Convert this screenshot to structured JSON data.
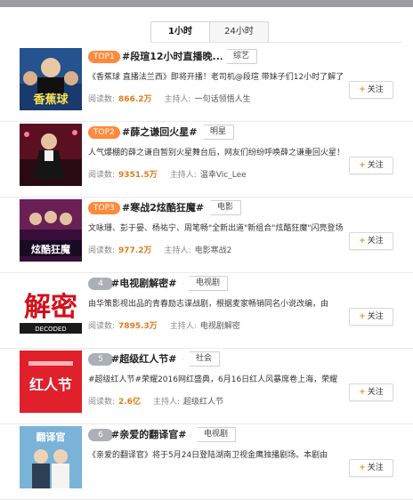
{
  "tabs": [
    {
      "label": "1小时",
      "active": true
    },
    {
      "label": "24小时",
      "active": false
    }
  ],
  "items": [
    {
      "rank": "TOP1",
      "title": "#段瑄12小时直播晚...",
      "category": "综艺",
      "description": "《香蕉球 直播法兰西》即将开播！老司机@段瑄 带妹子们12小时了解了",
      "read_label": "阅读数:",
      "read_count": "866.2万",
      "host_label": "主持人:",
      "host": "一句话领悟人生",
      "follow": "关注",
      "thumb_text": "香蕉球",
      "thumb_color": "#1a3a6e"
    },
    {
      "rank": "TOP2",
      "title": "#薛之谦回火星#",
      "category": "明星",
      "description": "人气爆棚的薛之谦自暂别火星舞台后，网友们纷纷呼唤薛之谦重回火星！",
      "read_label": "阅读数:",
      "read_count": "9351.5万",
      "host_label": "主持人:",
      "host": "温幸Vic_Lee",
      "follow": "关注",
      "thumb_text": "",
      "thumb_color": "#5a1020"
    },
    {
      "rank": "TOP3",
      "title": "#寒战2炫酷狂魔#",
      "category": "电影",
      "description": "文咏珊、彭于晏、杨祐宁、周笔畅\"全新出道\"新组合\"炫酷狂魔\"闪亮登场",
      "read_label": "阅读数:",
      "read_count": "977.2万",
      "host_label": "主持人:",
      "host": "电影寒战2",
      "follow": "关注",
      "thumb_text": "炫酷狂魔",
      "thumb_color": "#3a0e3a"
    },
    {
      "rank": "4",
      "title": "#电视剧解密#",
      "category": "电视剧",
      "description": "由华策影视出品的青春励志谍战剧，根据麦家畅销同名小说改编，由",
      "read_label": "阅读数:",
      "read_count": "7895.3万",
      "host_label": "主持人:",
      "host": "电视剧解密",
      "follow": "关注",
      "thumb_text": "解密",
      "thumb_sub": "DECODED",
      "thumb_color": "#ffffff"
    },
    {
      "rank": "5",
      "title": "#超级红人节#",
      "category": "社会",
      "description": "#超级红人节#荣耀2016网红盛典，6月16日红人风暴席卷上海，荣耀",
      "read_label": "阅读数:",
      "read_count": "2.6亿",
      "host_label": "主持人:",
      "host": "超级红人节",
      "follow": "关注",
      "thumb_text": "红人节",
      "thumb_color": "#e0202a"
    },
    {
      "rank": "6",
      "title": "#亲爱的翻译官#",
      "category": "电视剧",
      "description": "《亲爱的翻译官》将于5月24日登陆湖南卫视金鹰独播剧场。本剧由",
      "read_label": "阅读数:",
      "read_count": "",
      "host_label": "",
      "host": "",
      "follow": "关注",
      "thumb_text": "翻译官",
      "thumb_color": "#7ab3d8"
    }
  ]
}
